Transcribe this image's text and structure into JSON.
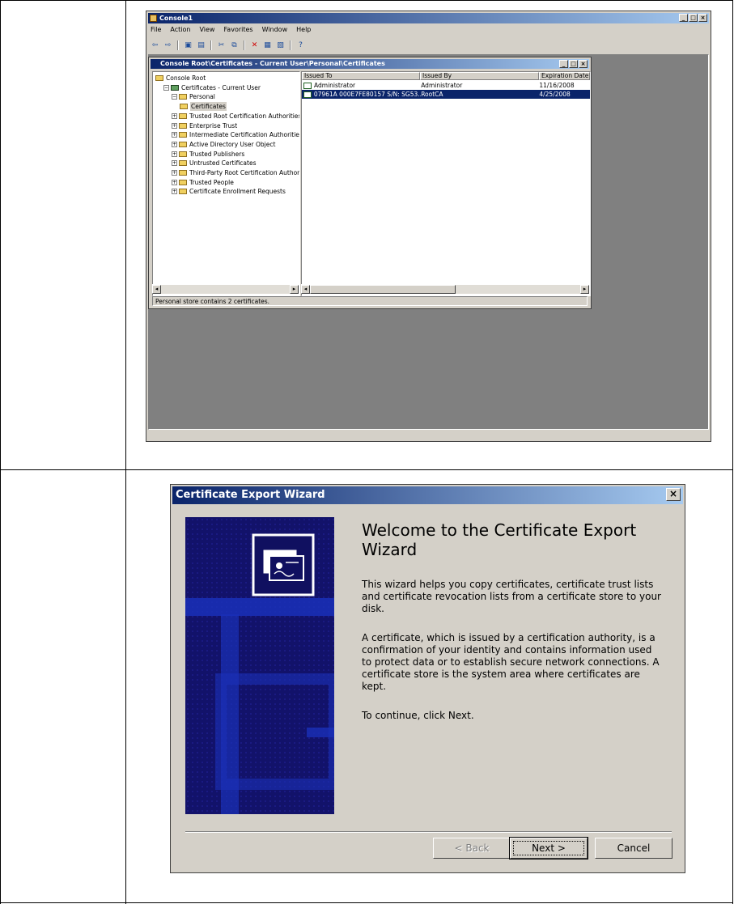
{
  "mmc": {
    "title": "Console1",
    "menu": [
      "File",
      "Action",
      "View",
      "Favorites",
      "Window",
      "Help"
    ],
    "child_title": "Console Root\\Certificates - Current User\\Personal\\Certificates",
    "tree": [
      {
        "label": "Console Root",
        "indent": 0,
        "expander": "",
        "icon": "folder-icon"
      },
      {
        "label": "Certificates - Current User",
        "indent": 1,
        "expander": "−",
        "icon": "certificate-store-icon"
      },
      {
        "label": "Personal",
        "indent": 2,
        "expander": "−",
        "icon": "folder-icon"
      },
      {
        "label": "Certificates",
        "indent": 3,
        "expander": "",
        "icon": "folder-open-icon",
        "selected": true
      },
      {
        "label": "Trusted Root Certification Authorities",
        "indent": 2,
        "expander": "+",
        "icon": "folder-icon"
      },
      {
        "label": "Enterprise Trust",
        "indent": 2,
        "expander": "+",
        "icon": "folder-icon"
      },
      {
        "label": "Intermediate Certification Authorities",
        "indent": 2,
        "expander": "+",
        "icon": "folder-icon"
      },
      {
        "label": "Active Directory User Object",
        "indent": 2,
        "expander": "+",
        "icon": "folder-icon"
      },
      {
        "label": "Trusted Publishers",
        "indent": 2,
        "expander": "+",
        "icon": "folder-icon"
      },
      {
        "label": "Untrusted Certificates",
        "indent": 2,
        "expander": "+",
        "icon": "folder-icon"
      },
      {
        "label": "Third-Party Root Certification Authorit",
        "indent": 2,
        "expander": "+",
        "icon": "folder-icon"
      },
      {
        "label": "Trusted People",
        "indent": 2,
        "expander": "+",
        "icon": "folder-icon"
      },
      {
        "label": "Certificate Enrollment Requests",
        "indent": 2,
        "expander": "+",
        "icon": "folder-icon"
      }
    ],
    "columns": [
      "Issued To",
      "Issued By",
      "Expiration Date"
    ],
    "rows": [
      {
        "issued_to": "Administrator",
        "issued_by": "Administrator",
        "expiration": "11/16/2008",
        "selected": false
      },
      {
        "issued_to": "07961A 000E7FE80157 S/N: SG53...",
        "issued_by": "RootCA",
        "expiration": "4/25/2008",
        "selected": true
      }
    ],
    "status": "Personal store contains 2 certificates."
  },
  "wizard": {
    "title": "Certificate Export Wizard",
    "heading": "Welcome to the Certificate Export Wizard",
    "para1": "This wizard helps you copy certificates, certificate trust lists and certificate revocation lists from a certificate store to your disk.",
    "para2": "A certificate, which is issued by a certification authority, is a confirmation of your identity and contains information used to protect data or to establish secure network connections. A certificate store is the system area where certificates are kept.",
    "para3": "To continue, click Next.",
    "back_label": "< Back",
    "next_label": "Next >",
    "cancel_label": "Cancel"
  }
}
